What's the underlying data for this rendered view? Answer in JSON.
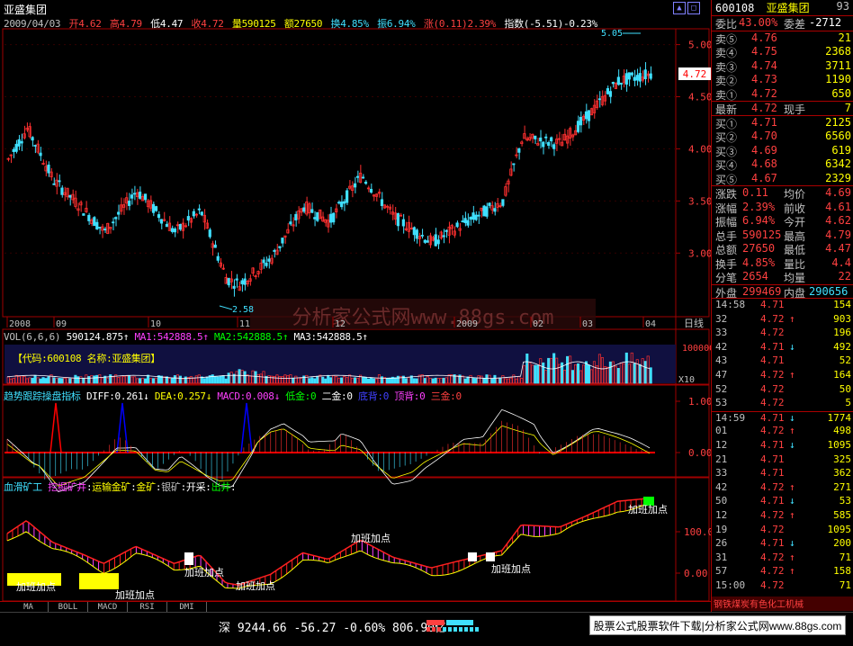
{
  "window": {
    "title": "亚盛集团"
  },
  "info_bar": {
    "date": "2009/04/03",
    "open": "开4.62",
    "high": "高4.79",
    "low": "低4.47",
    "close": "收4.72",
    "volume": "量590125",
    "amount": "额27650",
    "turnover": "换4.85%",
    "amplitude": "振6.94%",
    "change": "涨(0.11)2.39%",
    "index": "指数(-5.51)-0.23%"
  },
  "main_chart": {
    "price_labels": [
      "5.00",
      "4.50",
      "4.00",
      "3.50",
      "3.00"
    ],
    "current_price": "4.72",
    "high_mark": "5.05",
    "low_mark": "2.58",
    "watermark": "分析家公式网www.88gs.com",
    "date_labels": [
      "2008",
      "09",
      "10",
      "11",
      "12",
      "2009",
      "02",
      "03",
      "04"
    ],
    "period": "日线"
  },
  "vol_panel": {
    "title": "VOL(6,6,6)",
    "vol": "590124.875",
    "ma1": "MA1:542888.5",
    "ma2": "MA2:542888.5",
    "ma3": "MA3:542888.5",
    "code_info": "【代码:600108 名称:亚盛集团】",
    "y_label": "100000",
    "unit": "X10"
  },
  "trend_panel": {
    "title": "趋势跟踪操盘指标",
    "diff": "DIFF:0.261",
    "dea": "DEA:0.257",
    "macd": "MACD:0.008",
    "low_gold": "低金:0",
    "two_gold": "二金:0",
    "bottom_back": "底背:0",
    "top_back": "顶背:0",
    "three_gold": "三金:0",
    "y_labels": [
      "1.00",
      "0.00"
    ]
  },
  "bottom_panel": {
    "title": "血滑矿工",
    "dig": "挖掘矿井",
    "transport": "运输金矿",
    "gold": "金矿",
    "silver": "银矿",
    "mine": "开采",
    "out": "出井",
    "y_labels": [
      "100.00",
      "0.00"
    ],
    "annotations": [
      "加班加点",
      "加班加点",
      "加班加点",
      "加班加点",
      "加班加点",
      "加班加点",
      "加班加点"
    ]
  },
  "tabs": [
    "MA",
    "BOLL",
    "MACD",
    "RSI",
    "DMI"
  ],
  "status_bar": {
    "index": "深 9244.66  -56.27  -0.60% 806.90亿"
  },
  "ad": "股票公式股票软件下载|分析家公式网www.88gs.com",
  "quote": {
    "code": "600108",
    "name": "亚盛集团",
    "num": "93",
    "weibi_label": "委比",
    "weibi": "43.00%",
    "weicha_label": "委差",
    "weicha": "-2712",
    "sells": [
      {
        "l": "卖⑤",
        "p": "4.76",
        "v": "21"
      },
      {
        "l": "卖④",
        "p": "4.75",
        "v": "2368"
      },
      {
        "l": "卖③",
        "p": "4.74",
        "v": "3711"
      },
      {
        "l": "卖②",
        "p": "4.73",
        "v": "1190"
      },
      {
        "l": "卖①",
        "p": "4.72",
        "v": "650"
      }
    ],
    "latest_label": "最新",
    "latest": "4.72",
    "now_label": "现手",
    "now": "7",
    "buys": [
      {
        "l": "买①",
        "p": "4.71",
        "v": "2125"
      },
      {
        "l": "买②",
        "p": "4.70",
        "v": "6560"
      },
      {
        "l": "买③",
        "p": "4.69",
        "v": "619"
      },
      {
        "l": "买④",
        "p": "4.68",
        "v": "6342"
      },
      {
        "l": "买⑤",
        "p": "4.67",
        "v": "2329"
      }
    ],
    "stats": [
      [
        "涨跌",
        "0.11",
        "均价",
        "4.69"
      ],
      [
        "涨幅",
        "2.39%",
        "前收",
        "4.61"
      ],
      [
        "振幅",
        "6.94%",
        "今开",
        "4.62"
      ],
      [
        "总手",
        "590125",
        "最高",
        "4.79"
      ],
      [
        "总额",
        "27650",
        "最低",
        "4.47"
      ],
      [
        "换手",
        "4.85%",
        "量比",
        "4.4"
      ],
      [
        "分笔",
        "2654",
        "均量",
        "22"
      ]
    ],
    "outer_label": "外盘",
    "outer": "299469",
    "inner_label": "内盘",
    "inner": "290656"
  },
  "ticks": [
    [
      "14:58",
      "4.71",
      "",
      "154"
    ],
    [
      "32",
      "4.72",
      "↑",
      "903"
    ],
    [
      "33",
      "4.72",
      "",
      "196"
    ],
    [
      "42",
      "4.71",
      "↓",
      "492"
    ],
    [
      "43",
      "4.71",
      "",
      "52"
    ],
    [
      "47",
      "4.72",
      "↑",
      "164"
    ],
    [
      "52",
      "4.72",
      "",
      "50"
    ],
    [
      "53",
      "4.72",
      "",
      "5"
    ],
    [
      "14:59",
      "4.71",
      "↓",
      "1774"
    ],
    [
      "01",
      "4.72",
      "↑",
      "498"
    ],
    [
      "12",
      "4.71",
      "↓",
      "1095"
    ],
    [
      "21",
      "4.71",
      "",
      "325"
    ],
    [
      "33",
      "4.71",
      "",
      "362"
    ],
    [
      "42",
      "4.72",
      "↑",
      "271"
    ],
    [
      "50",
      "4.71",
      "↓",
      "53"
    ],
    [
      "12",
      "4.72",
      "↑",
      "585"
    ],
    [
      "19",
      "4.72",
      "",
      "1095"
    ],
    [
      "26",
      "4.71",
      "↓",
      "200"
    ],
    [
      "31",
      "4.72",
      "↑",
      "71"
    ],
    [
      "57",
      "4.72",
      "↑",
      "158"
    ],
    [
      "15:00",
      "4.72",
      "",
      "71"
    ]
  ],
  "ticker_scroll": "钢铁煤炭有色化工机械"
}
